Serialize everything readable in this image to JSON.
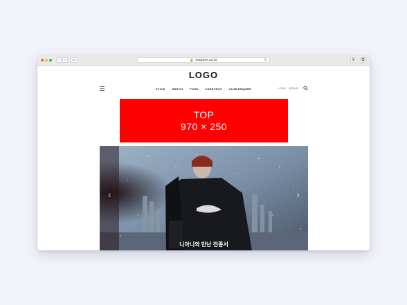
{
  "browser": {
    "url": "esquire.co.kr"
  },
  "header": {
    "logo": "LOGO",
    "nav": [
      "STYLE",
      "WATCH",
      "FOOD",
      "CAR&TECH",
      "CLUB ESQUIRE"
    ],
    "login": "LOGIN",
    "signup": "SIGNUP"
  },
  "ad": {
    "line1": "TOP",
    "line2": "970 × 250",
    "color": "#ff0000"
  },
  "hero": {
    "caption": "발렌시아가를 입은 블루 스키니아니와 만난 전종서",
    "caption_visible": "니아니와 만난 전종서",
    "prev_icon": "chevron-left-icon",
    "next_icon": "chevron-right-icon"
  }
}
